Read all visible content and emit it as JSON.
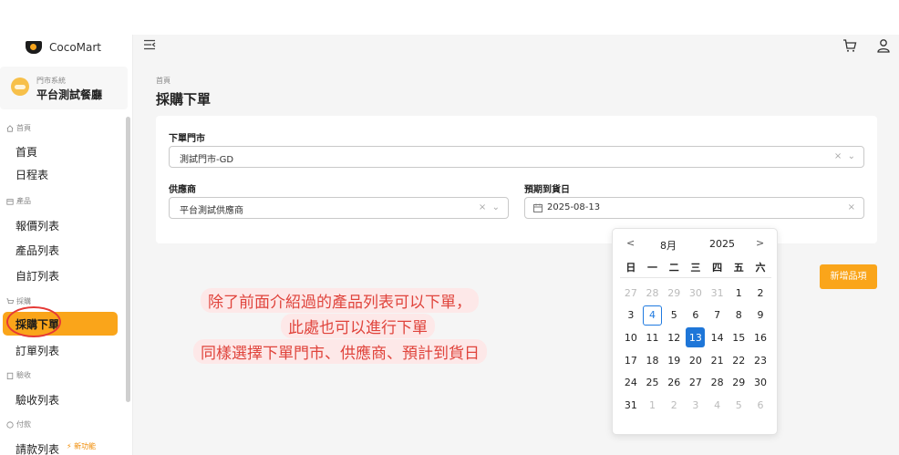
{
  "brand": {
    "name": "CocoMart"
  },
  "store": {
    "system": "門市系統",
    "name": "平台測試餐廳"
  },
  "sidebar": {
    "groups": {
      "home": "首頁",
      "products": "產品",
      "purchase": "採購",
      "receiving": "驗收",
      "payment": "付款"
    },
    "items": {
      "home": "首頁",
      "schedule": "日程表",
      "quote_list": "報價列表",
      "product_list": "產品列表",
      "custom_list": "自訂列表",
      "purchase_order": "採購下單",
      "order_list": "訂單列表",
      "receiving_list": "驗收列表",
      "payment_request": "請款列表"
    },
    "new_badge": "⚡ 新功能"
  },
  "page": {
    "breadcrumb": "首頁",
    "title": "採購下單"
  },
  "form": {
    "store_label": "下單門市",
    "store_value": "測試門市-GD",
    "supplier_label": "供應商",
    "supplier_value": "平台測試供應商",
    "date_label": "預期到貨日",
    "date_value": "2025-08-13"
  },
  "add_button": "新增品項",
  "calendar": {
    "month": "8月",
    "year": "2025",
    "prev": "<",
    "next": ">",
    "weekdays": [
      "日",
      "一",
      "二",
      "三",
      "四",
      "五",
      "六"
    ],
    "weeks": [
      [
        [
          "27",
          "m"
        ],
        [
          "28",
          "m"
        ],
        [
          "29",
          "m"
        ],
        [
          "30",
          "m"
        ],
        [
          "31",
          "m"
        ],
        [
          "1",
          ""
        ],
        [
          "2",
          ""
        ]
      ],
      [
        [
          "3",
          ""
        ],
        [
          "4",
          "today"
        ],
        [
          "5",
          ""
        ],
        [
          "6",
          ""
        ],
        [
          "7",
          ""
        ],
        [
          "8",
          ""
        ],
        [
          "9",
          ""
        ]
      ],
      [
        [
          "10",
          ""
        ],
        [
          "11",
          ""
        ],
        [
          "12",
          ""
        ],
        [
          "13",
          "selected"
        ],
        [
          "14",
          ""
        ],
        [
          "15",
          ""
        ],
        [
          "16",
          ""
        ]
      ],
      [
        [
          "17",
          ""
        ],
        [
          "18",
          ""
        ],
        [
          "19",
          ""
        ],
        [
          "20",
          ""
        ],
        [
          "21",
          ""
        ],
        [
          "22",
          ""
        ],
        [
          "23",
          ""
        ]
      ],
      [
        [
          "24",
          ""
        ],
        [
          "25",
          ""
        ],
        [
          "26",
          ""
        ],
        [
          "27",
          ""
        ],
        [
          "28",
          ""
        ],
        [
          "29",
          ""
        ],
        [
          "30",
          ""
        ]
      ],
      [
        [
          "31",
          ""
        ],
        [
          "1",
          "m"
        ],
        [
          "2",
          "m"
        ],
        [
          "3",
          "m"
        ],
        [
          "4",
          "m"
        ],
        [
          "5",
          "m"
        ],
        [
          "6",
          "m"
        ]
      ]
    ]
  },
  "annotation": {
    "line1": "除了前面介紹過的產品列表可以下單，",
    "line2": "此處也可以進行下單",
    "line3": "同樣選擇下單門市、供應商、預計到貨日"
  },
  "colors": {
    "accent": "#faa51a",
    "selected": "#1e76d8",
    "annotation": "#e0443c"
  }
}
